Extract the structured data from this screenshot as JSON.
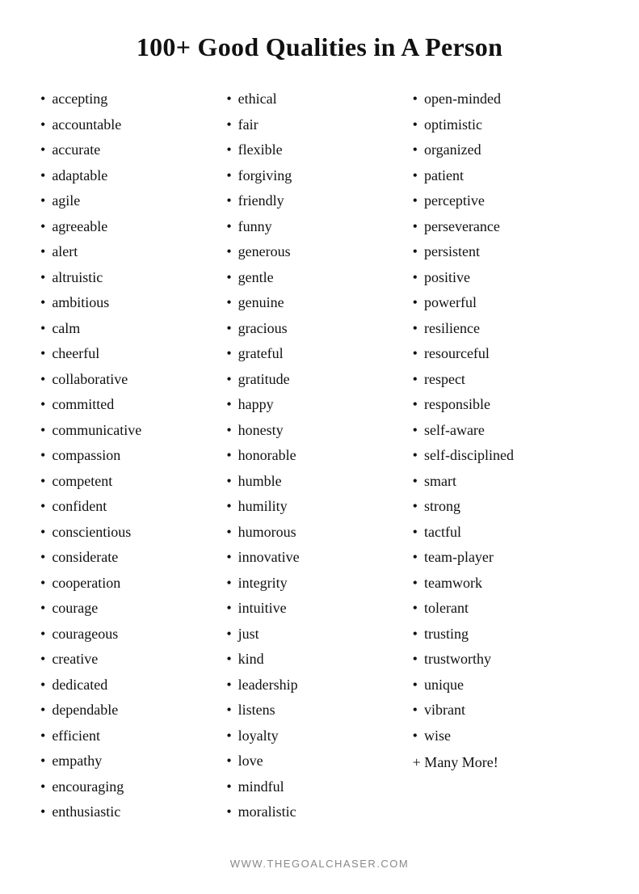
{
  "title": "100+ Good Qualities in A Person",
  "columns": [
    {
      "id": "col1",
      "items": [
        "accepting",
        "accountable",
        "accurate",
        "adaptable",
        "agile",
        "agreeable",
        "alert",
        "altruistic",
        "ambitious",
        "calm",
        "cheerful",
        "collaborative",
        "committed",
        "communicative",
        "compassion",
        "competent",
        "confident",
        "conscientious",
        "considerate",
        "cooperation",
        "courage",
        "courageous",
        "creative",
        "dedicated",
        "dependable",
        "efficient",
        "empathy",
        "encouraging",
        "enthusiastic"
      ]
    },
    {
      "id": "col2",
      "items": [
        "ethical",
        "fair",
        "flexible",
        "forgiving",
        "friendly",
        "funny",
        "generous",
        "gentle",
        "genuine",
        "gracious",
        "grateful",
        "gratitude",
        "happy",
        "honesty",
        "honorable",
        "humble",
        "humility",
        "humorous",
        "innovative",
        "integrity",
        "intuitive",
        "just",
        "kind",
        "leadership",
        "listens",
        "loyalty",
        "love",
        "mindful",
        "moralistic"
      ]
    },
    {
      "id": "col3",
      "items": [
        "open-minded",
        "optimistic",
        "organized",
        "patient",
        "perceptive",
        "perseverance",
        "persistent",
        "positive",
        "powerful",
        "resilience",
        "resourceful",
        "respect",
        "responsible",
        "self-aware",
        "self-disciplined",
        "smart",
        "strong",
        "tactful",
        "team-player",
        "teamwork",
        "tolerant",
        "trusting",
        "trustworthy",
        "unique",
        "vibrant",
        "wise"
      ],
      "extra": "+ Many More!"
    }
  ],
  "footer": "WWW.THEGOALCHASER.COM"
}
